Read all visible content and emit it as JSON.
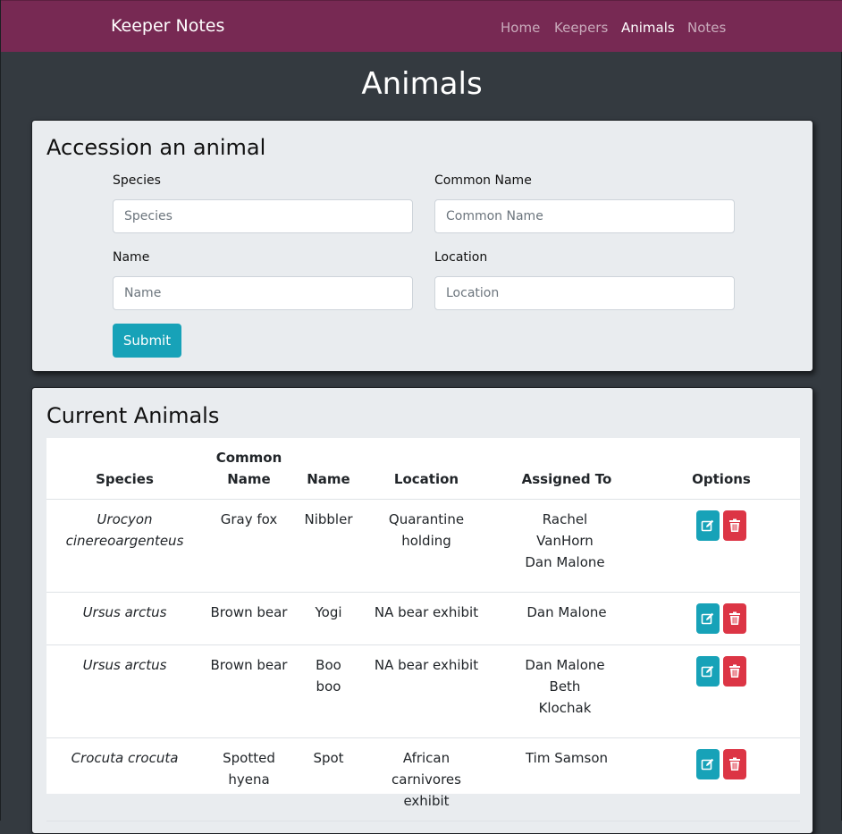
{
  "navbar": {
    "brand": "Keeper Notes",
    "links": [
      {
        "label": "Home",
        "active": false
      },
      {
        "label": "Keepers",
        "active": false
      },
      {
        "label": "Animals",
        "active": true
      },
      {
        "label": "Notes",
        "active": false
      }
    ]
  },
  "page": {
    "title": "Animals"
  },
  "form": {
    "title": "Accession an animal",
    "species_label": "Species",
    "species_placeholder": "Species",
    "common_name_label": "Common Name",
    "common_name_placeholder": "Common Name",
    "name_label": "Name",
    "name_placeholder": "Name",
    "location_label": "Location",
    "location_placeholder": "Location",
    "submit_label": "Submit"
  },
  "table": {
    "title": "Current Animals",
    "headers": {
      "species": "Species",
      "common_name": "Common Name",
      "name": "Name",
      "location": "Location",
      "assigned_to": "Assigned To",
      "options": "Options"
    },
    "rows": [
      {
        "species": "Urocyon cinereoargenteus",
        "common_name": "Gray fox",
        "name": "Nibbler",
        "location": "Quarantine holding",
        "assigned_to": [
          "Rachel VanHorn",
          "Dan Malone"
        ]
      },
      {
        "species": "Ursus arctus",
        "common_name": "Brown bear",
        "name": "Yogi",
        "location": "NA bear exhibit",
        "assigned_to": [
          "Dan Malone"
        ]
      },
      {
        "species": "Ursus arctus",
        "common_name": "Brown bear",
        "name": "Boo boo",
        "location": "NA bear exhibit",
        "assigned_to": [
          "Dan Malone",
          "Beth Klochak"
        ]
      },
      {
        "species": "Crocuta crocuta",
        "common_name": "Spotted hyena",
        "name": "Spot",
        "location": "African carnivores exhibit",
        "assigned_to": [
          "Tim Samson"
        ]
      }
    ]
  },
  "colors": {
    "navbar": "#772953",
    "background": "#343a40",
    "card": "#e9ecef",
    "info": "#17a2b8",
    "danger": "#dc3545"
  },
  "icons": {
    "edit": "edit-icon",
    "delete": "trash-icon"
  }
}
